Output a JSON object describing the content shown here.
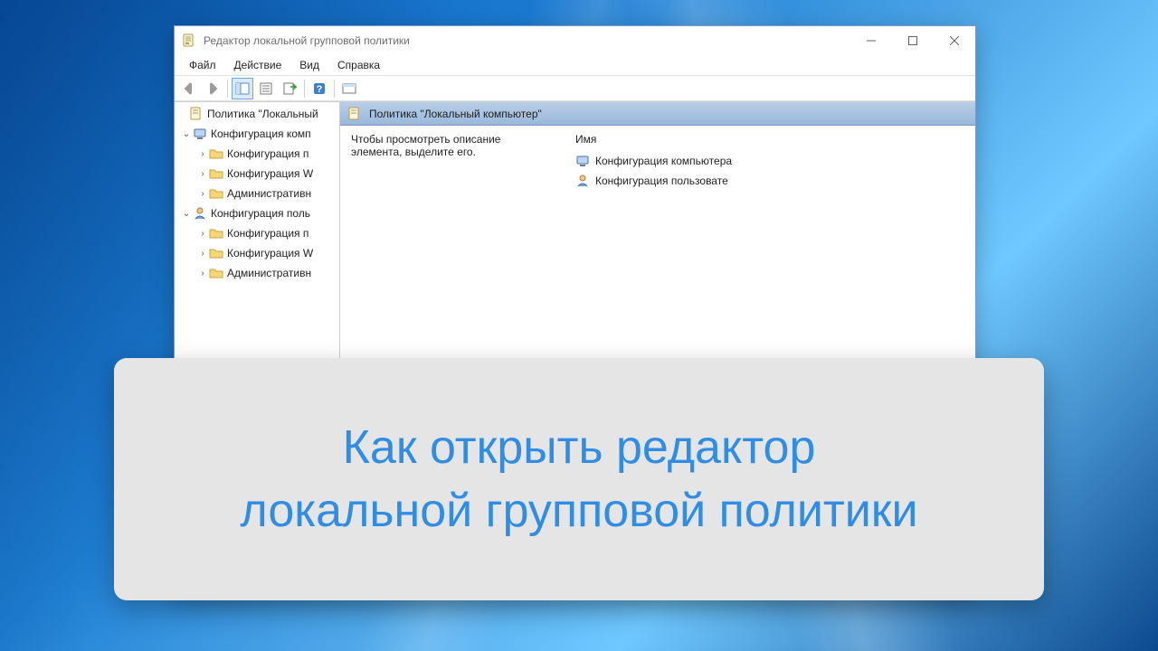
{
  "window": {
    "title": "Редактор локальной групповой политики"
  },
  "menu": {
    "file": "Файл",
    "action": "Действие",
    "view": "Вид",
    "help": "Справка"
  },
  "tree": {
    "root": "Политика \"Локальный",
    "comp": "Конфигурация комп",
    "comp_kids": {
      "0": "Конфигурация п",
      "1": "Конфигурация W",
      "2": "Административн"
    },
    "user": "Конфигурация поль",
    "user_kids": {
      "0": "Конфигурация п",
      "1": "Конфигурация W",
      "2": "Административн"
    }
  },
  "details": {
    "header": "Политика \"Локальный компьютер\"",
    "description": "Чтобы просмотреть описание элемента, выделите его.",
    "col_name": "Имя",
    "rows": {
      "0": "Конфигурация компьютера",
      "1": "Конфигурация пользовате"
    }
  },
  "overlay": {
    "line1": "Как открыть редактор",
    "line2": "локальной групповой политики"
  }
}
